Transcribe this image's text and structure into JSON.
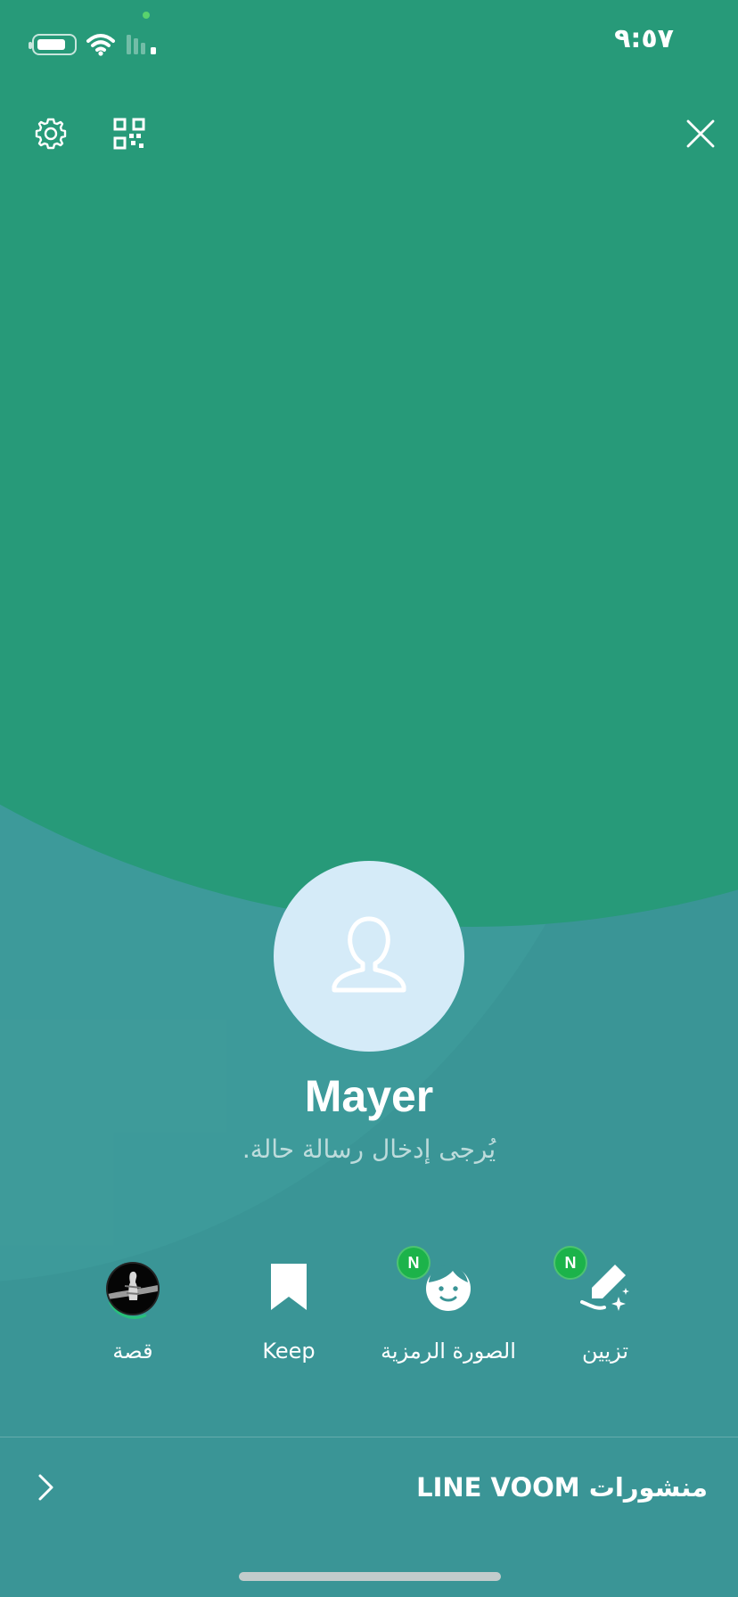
{
  "status_bar": {
    "time": "٩:٥٧",
    "battery_level": 0.82
  },
  "header": {
    "icons": [
      "gear-icon",
      "qr-code-icon",
      "close-icon"
    ]
  },
  "profile": {
    "name": "Mayer",
    "status_message": "يُرجى إدخال رسالة حالة."
  },
  "quick_actions": [
    {
      "label": "تزيين",
      "icon": "brush-sparkle-icon",
      "badge": "N"
    },
    {
      "label": "الصورة الرمزية",
      "icon": "avatar-face-icon",
      "badge": "N"
    },
    {
      "label": "Keep",
      "icon": "bookmark-icon"
    },
    {
      "label": "قصة",
      "icon": "story-avatar-icon"
    }
  ],
  "voom": {
    "title": "منشورات LINE VOOM",
    "icon": "chevron-right-icon"
  },
  "colors": {
    "green_background": "#279a79",
    "teal_background": "#3a9596",
    "badge_green": "#1cb34a",
    "avatar_background": "#d5ebf8"
  }
}
